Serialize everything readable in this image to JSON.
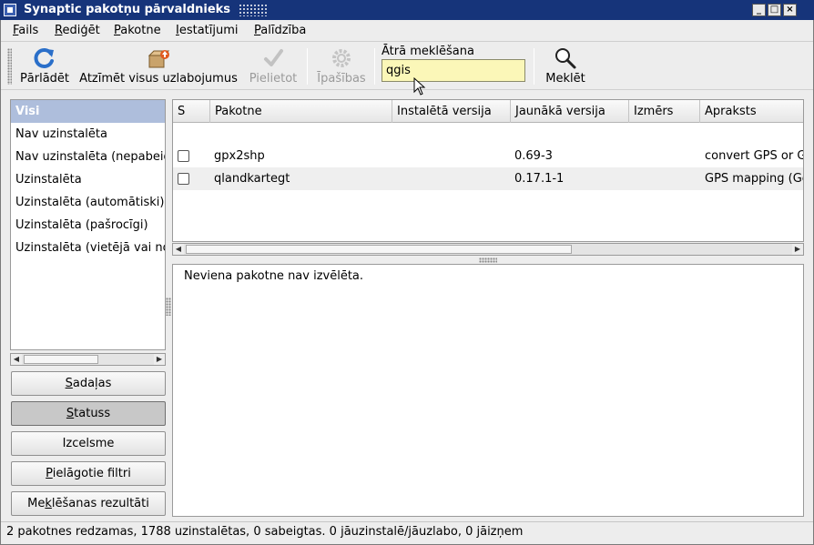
{
  "window": {
    "title": "Synaptic pakotņu pārvaldnieks",
    "buttons": [
      "_",
      "□",
      "×"
    ]
  },
  "menubar": {
    "items": [
      {
        "key": "F",
        "rest": "ails"
      },
      {
        "key": "R",
        "rest": "ediģēt"
      },
      {
        "key": "P",
        "rest": "akotne"
      },
      {
        "key": "I",
        "rest": "estatījumi"
      },
      {
        "key": "P",
        "rest": "alīdzība"
      }
    ]
  },
  "toolbar": {
    "reload": {
      "label": "Pārlādēt",
      "icon": "reload-icon"
    },
    "mark_upgrades": {
      "label": "Atzīmēt visus uzlabojumus",
      "icon": "upgrade-icon"
    },
    "apply": {
      "label": "Pielietot",
      "icon": "checkmark-icon",
      "enabled": false
    },
    "properties": {
      "label": "Īpašības",
      "icon": "gear-icon",
      "enabled": false
    },
    "quick_search": {
      "label": "Ātrā meklēšana",
      "value": "qgis"
    },
    "search": {
      "label": "Meklēt",
      "icon": "magnifier-icon"
    }
  },
  "filters": {
    "items": [
      "Visi",
      "Nav uzinstalēta",
      "Nav uzinstalēta (nepabeigta konfigurācija)",
      "Uzinstalēta",
      "Uzinstalēta (automātiski)",
      "Uzinstalēta (pašrocīgi)",
      "Uzinstalēta (vietējā vai novecojusi)"
    ],
    "selected_index": 0
  },
  "side_buttons": {
    "sections": {
      "key": "S",
      "rest": "adaļas"
    },
    "status": {
      "key": "S",
      "rest": "tatuss"
    },
    "origin": {
      "label": "Izcelsme"
    },
    "custom_filters": {
      "key": "P",
      "rest": "ielāgotie filtri"
    },
    "search_results": {
      "pre": "Me",
      "key": "k",
      "rest": "lēšanas rezultāti"
    },
    "active": "status"
  },
  "table": {
    "columns": [
      "S",
      "Pakotne",
      "Instalētā versija",
      "Jaunākā versija",
      "Izmērs",
      "Apraksts"
    ],
    "rows": [
      {
        "checked": false,
        "package": "gpx2shp",
        "installed": "",
        "latest": "0.69-3",
        "size": "",
        "description": "convert GPS or GPX"
      },
      {
        "checked": false,
        "package": "qlandkartegt",
        "installed": "",
        "latest": "0.17.1-1",
        "size": "",
        "description": "GPS mapping (GeoTiff"
      }
    ]
  },
  "details": {
    "message": "Neviena pakotne nav izvēlēta."
  },
  "status": {
    "text": "2 pakotnes redzamas, 1788 uzinstalētas, 0 sabeigtas. 0 jāuzinstalē/jāuzlabo, 0 jāizņem"
  },
  "colors": {
    "titlebar": "#16347a",
    "selection": "#aebedc",
    "search_field": "#fbf7b8"
  }
}
